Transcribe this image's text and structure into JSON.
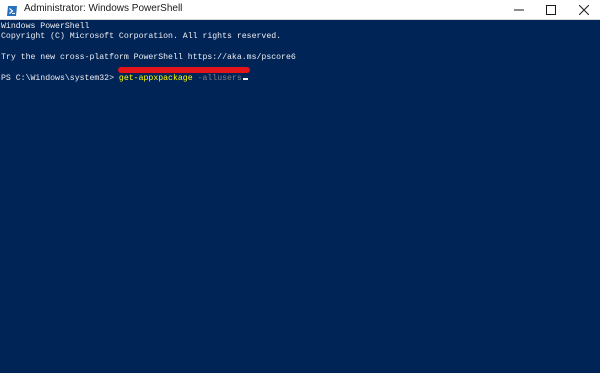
{
  "window": {
    "title": "Administrator: Windows PowerShell",
    "background_color": "#012456",
    "app_icon": "powershell-icon",
    "controls": [
      "minimize-icon",
      "maximize-icon",
      "close-icon"
    ]
  },
  "console": {
    "header_line": "Windows PowerShell",
    "copyright_line": "Copyright (C) Microsoft Corporation. All rights reserved.",
    "info_line": "Try the new cross-platform PowerShell https://aka.ms/pscore6",
    "prompt": "PS C:\\Windows\\system32> ",
    "command": "get-appxpackage",
    "parameter": " -allusers",
    "text_color": "#eeedf0",
    "command_color": "#ffff00",
    "parameter_color": "#808080"
  },
  "annotation": {
    "highlight_color": "#e2141a"
  }
}
